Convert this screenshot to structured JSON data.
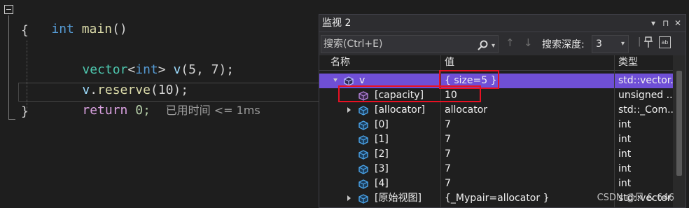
{
  "editor": {
    "line1": {
      "kw": "int",
      "fn": "main",
      "paren": "()"
    },
    "line2": "{",
    "line3": {
      "type": "vector",
      "lt": "<",
      "tparam": "int",
      "gt": ">",
      "var": "v",
      "args": "(5, 7);"
    },
    "line4": {
      "var": "v",
      "dot": ".",
      "fn": "reserve",
      "args": "(10);"
    },
    "line5": {
      "kw": "return",
      "num": "0;",
      "elapsed": "已用时间 <= 1ms"
    },
    "line6": "}"
  },
  "watch": {
    "title": "监视 2",
    "title_buttons": {
      "dropdown": "▾",
      "pin": "⊓",
      "close": "✕"
    },
    "search": {
      "placeholder": "搜索(Ctrl+E)"
    },
    "nav": {
      "up": "↑",
      "down": "↓"
    },
    "depth": {
      "label": "搜索深度:",
      "value": "3"
    },
    "columns": {
      "name": "名称",
      "value": "值",
      "type": "类型"
    },
    "rows": [
      {
        "name": "v",
        "value": "{ size=5 }",
        "type": "std::vector..."
      },
      {
        "name": "[capacity]",
        "value": "10",
        "type": "unsigned ..."
      },
      {
        "name": "[allocator]",
        "value": "allocator",
        "type": "std::_Com..."
      },
      {
        "name": "[0]",
        "value": "7",
        "type": "int"
      },
      {
        "name": "[1]",
        "value": "7",
        "type": "int"
      },
      {
        "name": "[2]",
        "value": "7",
        "type": "int"
      },
      {
        "name": "[3]",
        "value": "7",
        "type": "int"
      },
      {
        "name": "[4]",
        "value": "7",
        "type": "int"
      },
      {
        "name": "[原始视图]",
        "value": "{_Mypair=allocator }",
        "type": "std::vector..."
      }
    ]
  },
  "watermark": "CSDN @风 & 646",
  "colors": {
    "selection": "#6f4fd6",
    "highlight_box": "#e81123",
    "icon_blue": "#4aa3e8",
    "icon_purple": "#b180d7"
  }
}
